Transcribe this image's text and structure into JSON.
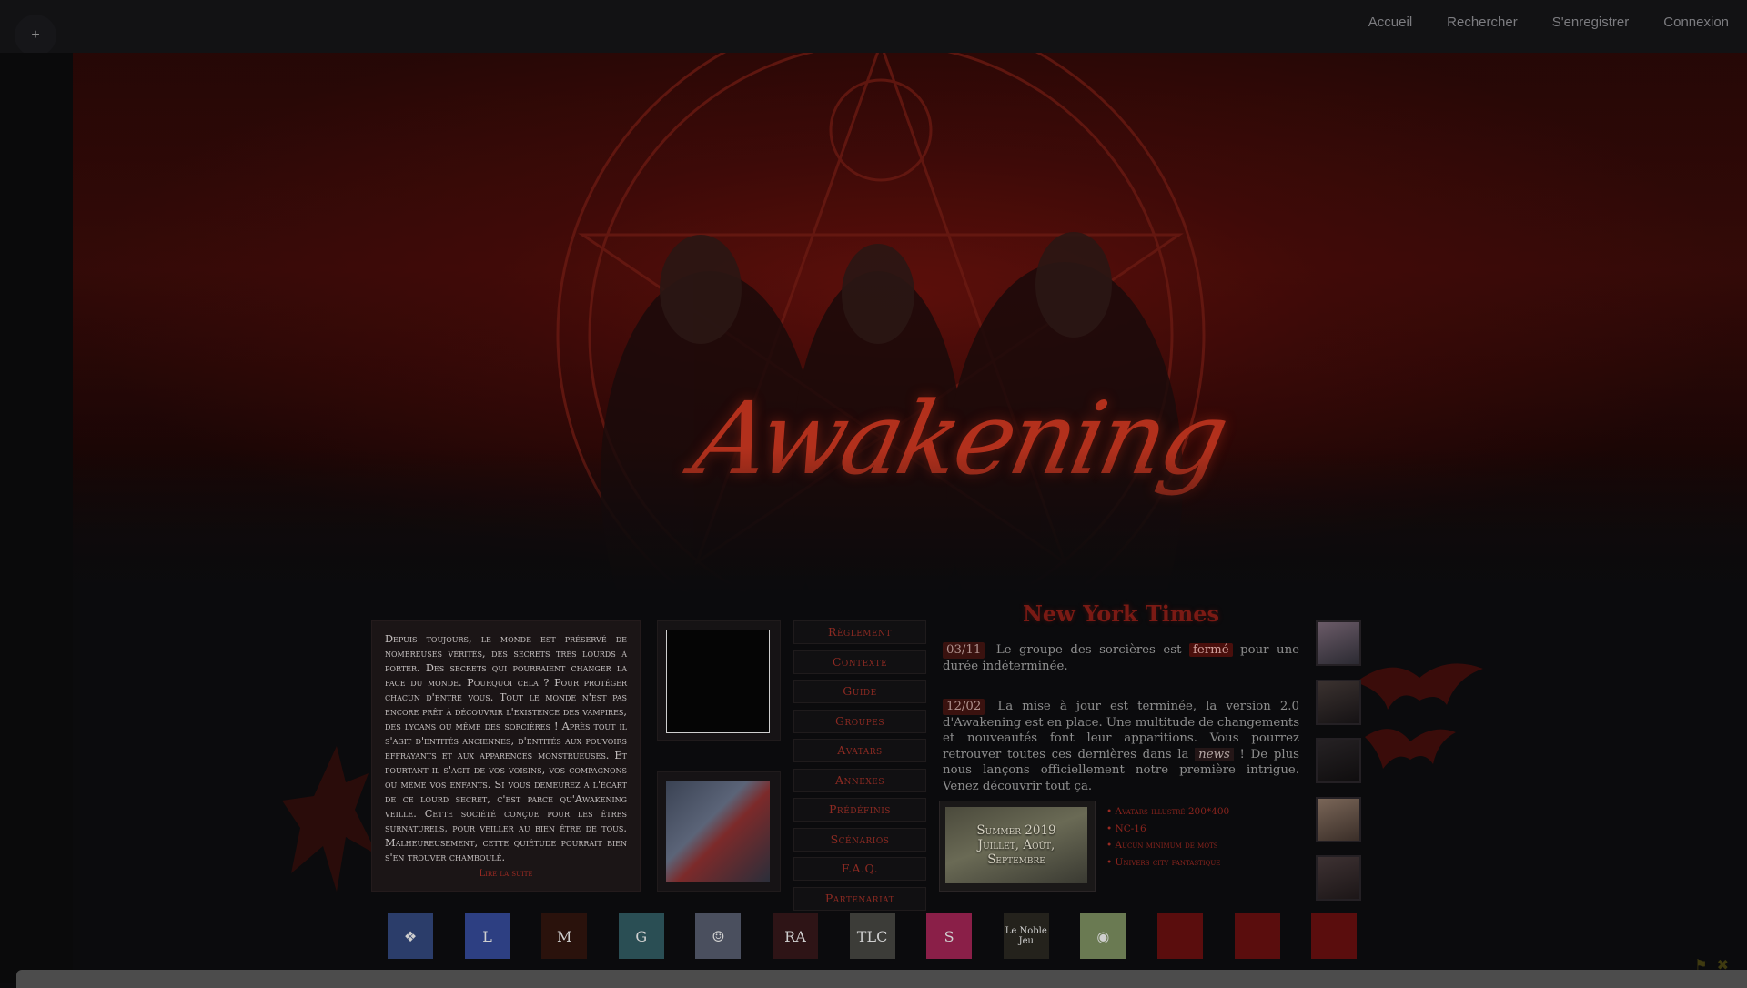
{
  "nav": {
    "plus": "+",
    "items": [
      "Accueil",
      "Rechercher",
      "S'enregistrer",
      "Connexion"
    ]
  },
  "hero": {
    "title": "Awakening"
  },
  "intro": {
    "text": "Depuis toujours, le monde est préservé de nombreuses vérités, des secrets très lourds à porter. Des secrets qui pourraient changer la face du monde. Pourquoi cela ? Pour protéger chacun d'entre vous. Tout le monde n'est pas encore prêt à découvrir l'existence des vampires, des lycans ou même des sorcières ! Après tout il s'agit d'entités anciennes, d'entités aux pouvoirs effrayants et aux apparences monstrueuses. Et pourtant il s'agit de vos voisins, vos compagnons ou même vos enfants. Si vous demeurez à l'écart de ce lourd secret, c'est parce qu'Awakening veille. Cette société conçue pour les êtres surnaturels, pour veiller au bien être de tous. Malheureusement, cette quiétude pourrait bien s'en trouver chamboulé.",
    "more": "Lire la suite"
  },
  "menu": [
    "Règlement",
    "Contexte",
    "Guide",
    "Groupes",
    "Avatars",
    "Annexes",
    "Prédéfinis",
    "Scénarios",
    "F.A.Q.",
    "Partenariat"
  ],
  "news": {
    "title": "New York Times",
    "item1": {
      "date": "03/11",
      "text_before": "Le groupe des sorcières est",
      "highlight": "fermé",
      "text_after": "pour une durée indéterminée."
    },
    "item2": {
      "date": "12/02",
      "text_before": "La mise à jour est terminée, la version 2.0 d'Awakening est en place. Une multitude de changements et nouveautés font leur apparitions. Vous pourrez retrouver toutes ces dernières dans la",
      "link": "news",
      "text_after": "! De plus nous lançons officiellement notre première intrigue. Venez découvrir tout ça."
    }
  },
  "summer": {
    "line1": "Summer 2019",
    "line2": "Juillet, Août,",
    "line3": "Septembre"
  },
  "features": [
    "Avatars illustré 200*400",
    "NC-16",
    "Aucun minimum de mots",
    "Univers city fantastique"
  ],
  "partners": [
    {
      "label": "❖",
      "bg": "#2b3d6a"
    },
    {
      "label": "L",
      "bg": "#2d3f82"
    },
    {
      "label": "M",
      "bg": "#2a120c"
    },
    {
      "label": "G",
      "bg": "#2a4e54"
    },
    {
      "label": "☺",
      "bg": "#4a4f5e"
    },
    {
      "label": "RA",
      "bg": "#2e1416"
    },
    {
      "label": "TLC",
      "bg": "#3c3c38"
    },
    {
      "label": "S",
      "bg": "#8a1f48"
    },
    {
      "label": "Le Noble Jeu",
      "bg": "#24221c"
    },
    {
      "label": "◉",
      "bg": "#6a7a52"
    },
    {
      "label": "",
      "bg": "#5a0d0d"
    },
    {
      "label": "",
      "bg": "#5a0d0d"
    },
    {
      "label": "",
      "bg": "#5a0d0d"
    }
  ],
  "colors": {
    "accent": "#8c2a22",
    "background": "#0b0b0d"
  }
}
